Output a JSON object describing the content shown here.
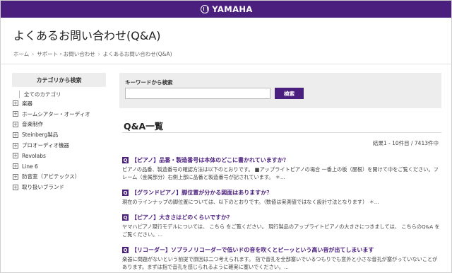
{
  "header": {
    "brand": "YAMAHA"
  },
  "page": {
    "title": "よくあるお問い合わせ(Q&A)"
  },
  "breadcrumb": [
    "ホーム",
    "サポート・お問い合わせ",
    "よくあるお問い合わせ(Q&A)"
  ],
  "sidebar": {
    "heading": "カテゴリから検索",
    "all_label": "全てのカテゴリ",
    "items": [
      "楽器",
      "ホームシアター・オーディオ",
      "音楽制作",
      "Steinberg製品",
      "プロオーディオ機器",
      "Revolabs",
      "Line 6",
      "防音室（アビテックス）",
      "取り扱いブランド"
    ]
  },
  "search": {
    "label": "キーワードから検索",
    "value": "",
    "button": "検索"
  },
  "qa": {
    "heading": "Q&A一覧",
    "result_count": "結果1 - 10件目 / 7413件中",
    "badge": "Q",
    "items": [
      {
        "title": "【ピアノ】品番・製造番号は本体のどこに書かれていますか？",
        "desc": "ピアノの品番、製造番号の確認方法は以下のとおりです。 ■アップライトピアノの場合 一番上の板（屋根）を開けて中をご覧ください。フレーム（金属部分）右側上部に品番と製造番号が記されています。 ＊..."
      },
      {
        "title": "【グランドピアノ】脚位置が分かる図面はありますか？",
        "desc": "現在のラインナップの脚位置については、以下のとおりです。（数値は実測値ではなく設計寸法となります） ＊..."
      },
      {
        "title": "【ピアノ】大きさはどのくらいですか？",
        "desc": "ヤマハピアノ現行モデルについては、 こちら をご覧ください。 現行製品のアップライトピアノの大きさにつきましては、 こちらのQ&A をご覧ください。..."
      },
      {
        "title": "【リコーダー】ソプラノリコーダーで低いドの音を吹くとピーッという高い音が出てしまいます",
        "desc": "楽器に問題がないという前提で原因は二つ考えられます。 指で音孔を全部塞いでいるつもりでも意外と小さな音孔が塞がっていないことがあります。まずは指で音孔を感じられるように確実に塞いでください。..."
      }
    ]
  }
}
